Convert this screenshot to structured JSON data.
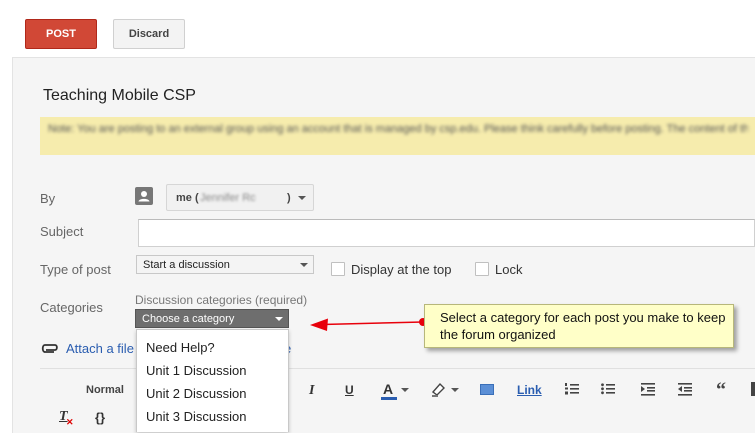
{
  "toolbar": {
    "post_label": "POST",
    "discard_label": "Discard"
  },
  "group": {
    "title": "Teaching Mobile CSP",
    "notice": "Note: You are posting to an external group using an account that is managed by csp.edu. Please think carefully before posting. The content of these discussions may be publicly visible."
  },
  "form": {
    "by_label": "By",
    "by_value_prefix": "me (",
    "by_value_blurred": "Jennifer Rosato",
    "by_value_suffix": ")",
    "subject_label": "Subject",
    "subject_value": "",
    "type_label": "Type of post",
    "type_value": "Start a discussion",
    "display_top_label": "Display at the top",
    "lock_label": "Lock",
    "categories_label": "Categories",
    "categories_hint": "Discussion categories (required)",
    "categories_select": "Choose a category",
    "category_options": [
      "Need Help?",
      "Unit 1 Discussion",
      "Unit 2 Discussion",
      "Unit 3 Discussion"
    ],
    "attach_label": "Attach a file"
  },
  "editor": {
    "format_label": "Normal",
    "italic": "I",
    "underline": "U",
    "font_color": "A",
    "link_label": "Link",
    "code_label": "{}",
    "clear_format": "T"
  },
  "annotation": {
    "callout_text": "Select a category for each post you make to keep the forum organized",
    "arrow_color": "#e8000b"
  },
  "colors": {
    "post_button": "#d14836",
    "link": "#2a5db0",
    "notice_bg": "#f6ecad"
  }
}
